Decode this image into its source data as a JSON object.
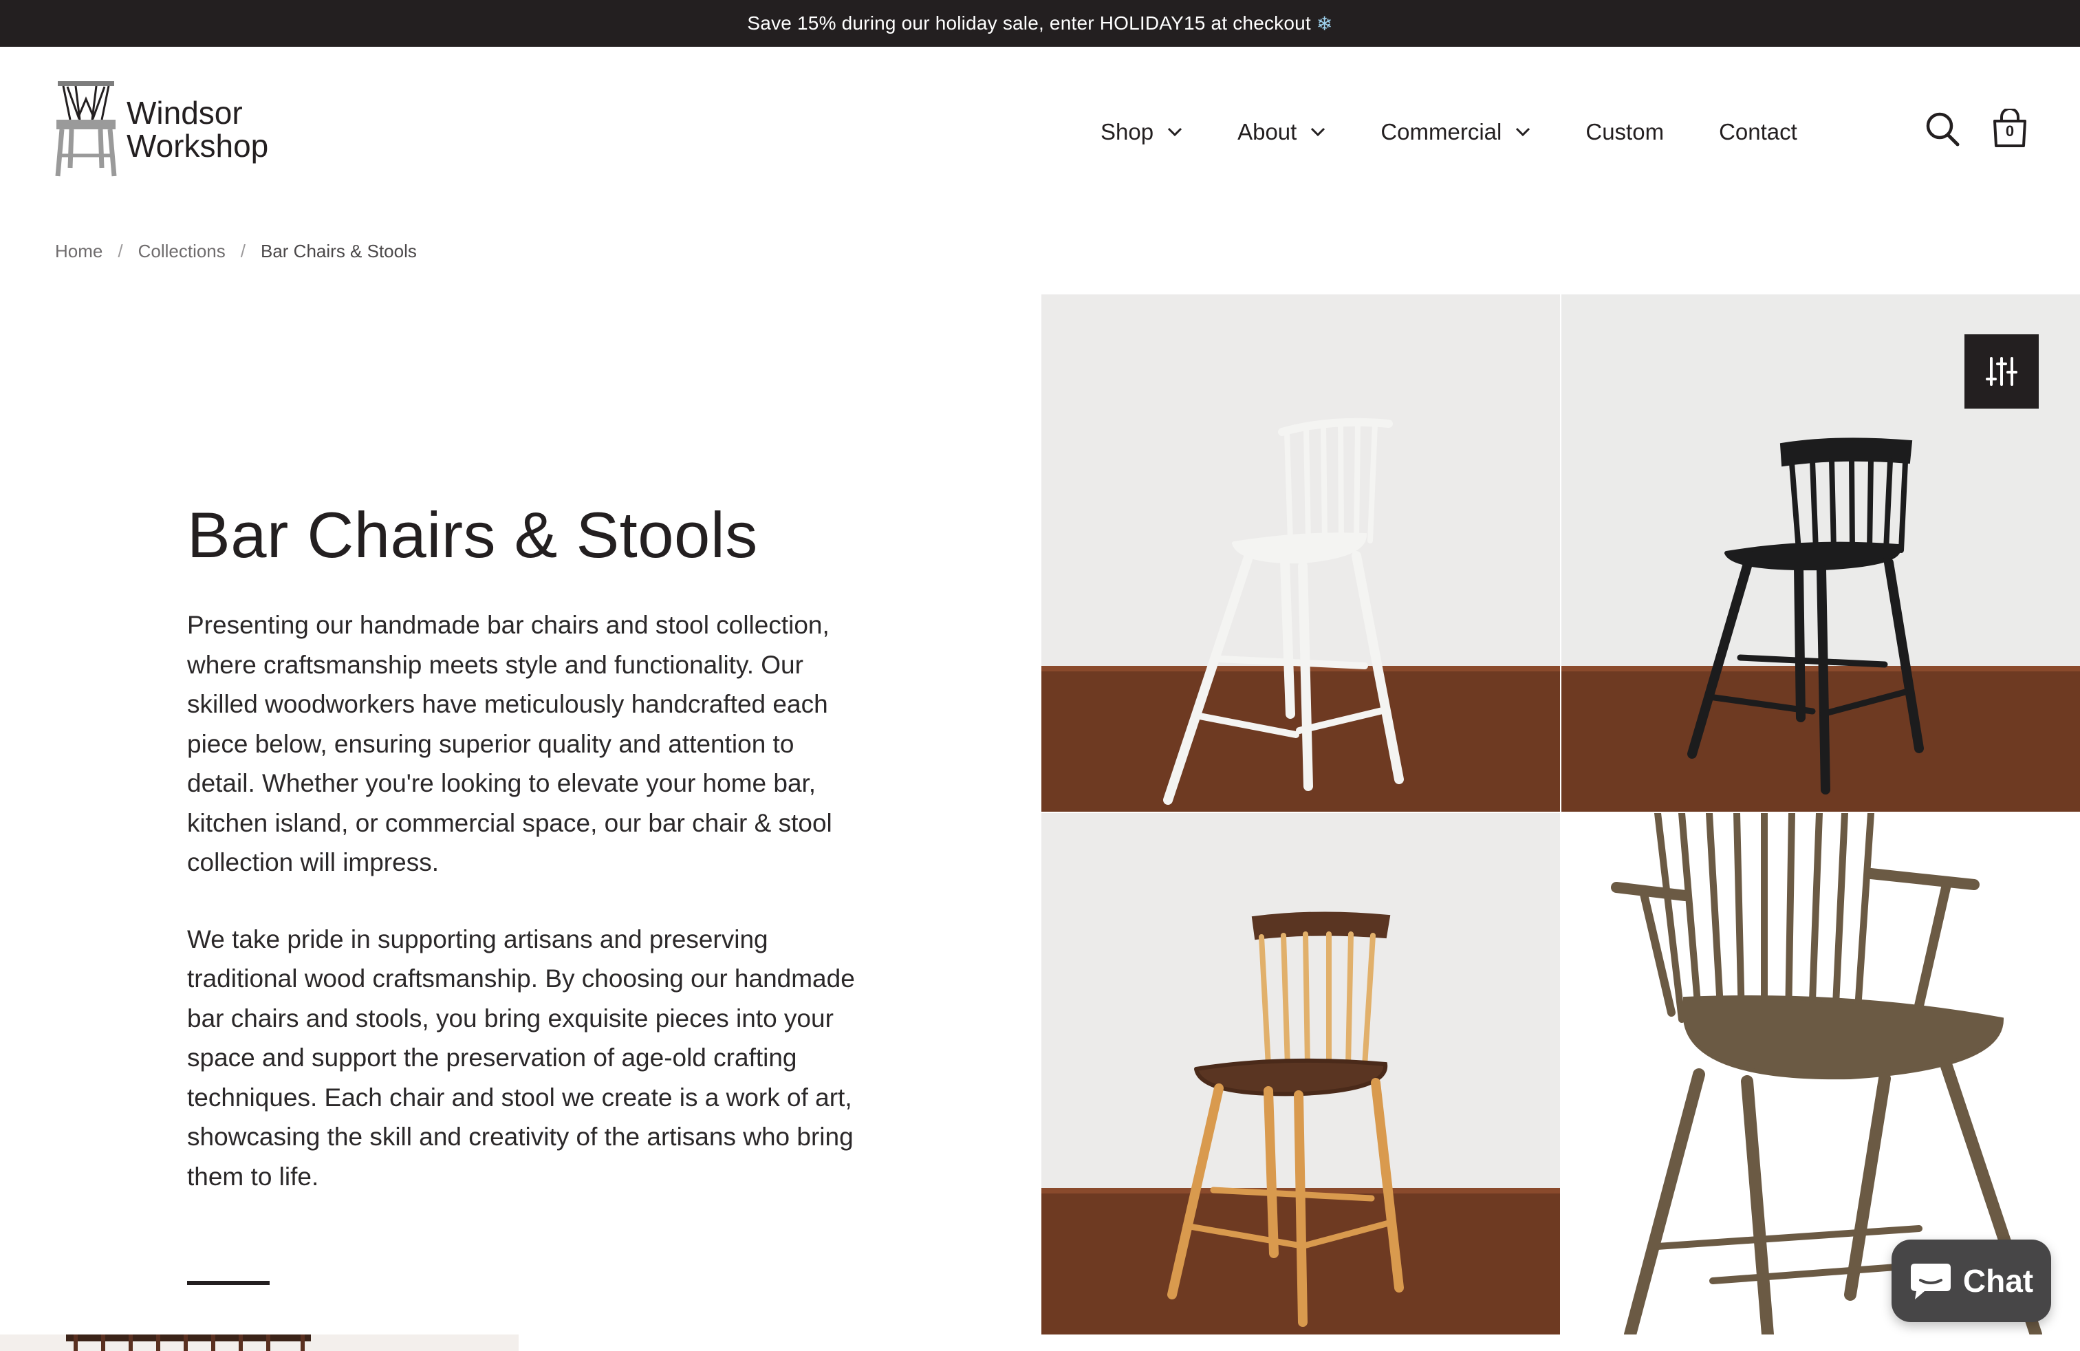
{
  "announcement": {
    "text": "Save 15% during our holiday sale, enter HOLIDAY15 at checkout",
    "icon": "snowflake-icon"
  },
  "header": {
    "logo": {
      "line1": "Windsor",
      "line2": "Workshop",
      "icon": "windsor-chair-logo-icon"
    },
    "nav": [
      {
        "label": "Shop",
        "has_dropdown": true
      },
      {
        "label": "About",
        "has_dropdown": true
      },
      {
        "label": "Commercial",
        "has_dropdown": true
      },
      {
        "label": "Custom",
        "has_dropdown": false
      },
      {
        "label": "Contact",
        "has_dropdown": false
      }
    ],
    "search_icon": "search-icon",
    "cart": {
      "icon": "shopping-bag-icon",
      "count": "0"
    }
  },
  "breadcrumb": {
    "items": [
      "Home",
      "Collections",
      "Bar Chairs & Stools"
    ],
    "separator": "/"
  },
  "collection": {
    "title": "Bar Chairs & Stools",
    "paragraphs": [
      "Presenting our handmade bar chairs and stool collection, where craftsmanship meets style and functionality. Our skilled woodworkers have meticulously handcrafted each piece below, ensuring superior quality and attention to detail. Whether you're looking to elevate your home bar, kitchen island, or commercial space, our bar chair & stool collection will impress.",
      "We take pride in supporting artisans and preserving traditional wood craftsmanship. By choosing our handmade bar chairs and stools, you bring exquisite pieces into your space and support the preservation of age-old crafting techniques. Each chair and stool we create is a work of art, showcasing the skill and creativity of the artisans who bring them to life."
    ]
  },
  "gallery": {
    "filter_icon": "filter-sliders-icon",
    "images": [
      {
        "subject": "white-bar-stool",
        "color": "#f4f4f2"
      },
      {
        "subject": "black-bar-stool",
        "color": "#1c1c1d"
      },
      {
        "subject": "walnut-and-maple-counter-stool",
        "color": "#d9a35a"
      },
      {
        "subject": "brown-windsor-bar-chair",
        "color": "#6b5a44"
      }
    ]
  },
  "chat": {
    "label": "Chat",
    "icon": "chat-bubble-icon"
  },
  "colors": {
    "announcement_bg": "#231f20",
    "text": "#231f20",
    "wall": "#ecebe9",
    "floor": "#6e3a22",
    "chat_bg": "#474647"
  }
}
